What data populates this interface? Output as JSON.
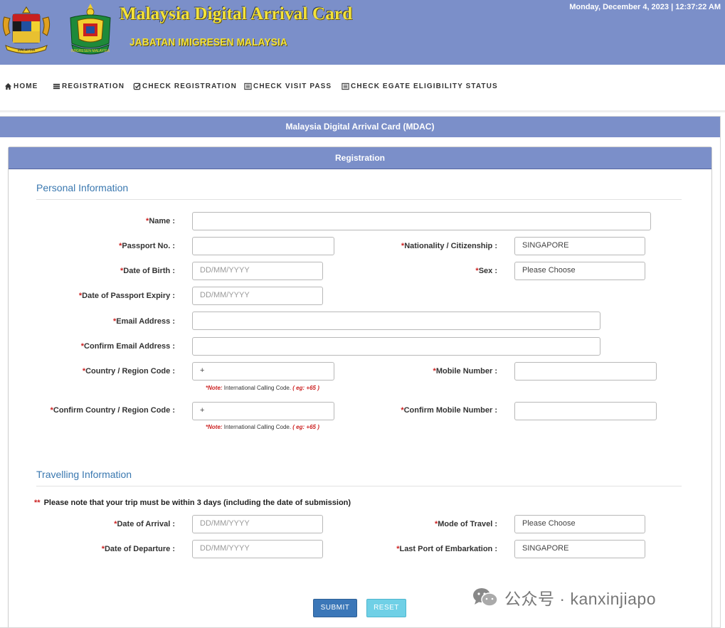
{
  "header": {
    "title": "Malaysia Digital Arrival Card",
    "subtitle": "JABATAN IMIGRESEN MALAYSIA",
    "datetime": "Monday, December 4, 2023 | 12:37:22 AM",
    "emblem_left_text": "MALAYSIA",
    "emblem_right_text": "IMIGRESEN MALAYSIA"
  },
  "nav": {
    "home": "HOME",
    "registration": "REGISTRATION",
    "check_registration": "CHECK REGISTRATION",
    "check_visit_pass": "CHECK VISIT PASS",
    "check_egate": "CHECK EGATE ELIGIBILITY STATUS"
  },
  "panel": {
    "title": "Malaysia Digital Arrival Card (MDAC)",
    "sub_title": "Registration"
  },
  "personal": {
    "section_title": "Personal Information",
    "name_label": "Name :",
    "passport_label": "Passport No. :",
    "nationality_label": "Nationality / Citizenship :",
    "nationality_value": "SINGAPORE",
    "dob_label": "Date of Birth :",
    "dob_placeholder": "DD/MM/YYYY",
    "sex_label": "Sex :",
    "sex_value": "Please Choose",
    "expiry_label": "Date of Passport Expiry :",
    "expiry_placeholder": "DD/MM/YYYY",
    "email_label": "Email Address :",
    "confirm_email_label": "Confirm Email Address :",
    "country_code_label": "Country / Region Code :",
    "country_code_value": "+",
    "mobile_label": "Mobile Number :",
    "confirm_country_code_label": "Confirm Country / Region Code :",
    "confirm_country_code_value": "+",
    "confirm_mobile_label": "Confirm Mobile Number :",
    "note_prefix": "*Note:",
    "note_text": " International Calling Code. ",
    "note_example": "( eg: +65 )"
  },
  "travel": {
    "section_title": "Travelling Information",
    "trip_note_marker": "**",
    "trip_note": "Please note that your trip must be within 3 days (including the date of submission)",
    "arrival_label": "Date of Arrival :",
    "arrival_placeholder": "DD/MM/YYYY",
    "mode_label": "Mode of Travel :",
    "mode_value": "Please Choose",
    "departure_label": "Date of Departure :",
    "departure_placeholder": "DD/MM/YYYY",
    "port_label": "Last Port of Embarkation :",
    "port_value": "SINGAPORE"
  },
  "actions": {
    "submit": "SUBMIT",
    "reset": "RESET"
  },
  "watermark": {
    "text": "公众号 · kanxinjiapo"
  },
  "colors": {
    "header_blue": "#7b8fc9",
    "title_yellow": "#f3e23a",
    "section_blue": "#3a78b0",
    "required_red": "#cc2222",
    "submit_blue": "#3b77b8",
    "reset_cyan": "#6fd0e6"
  }
}
